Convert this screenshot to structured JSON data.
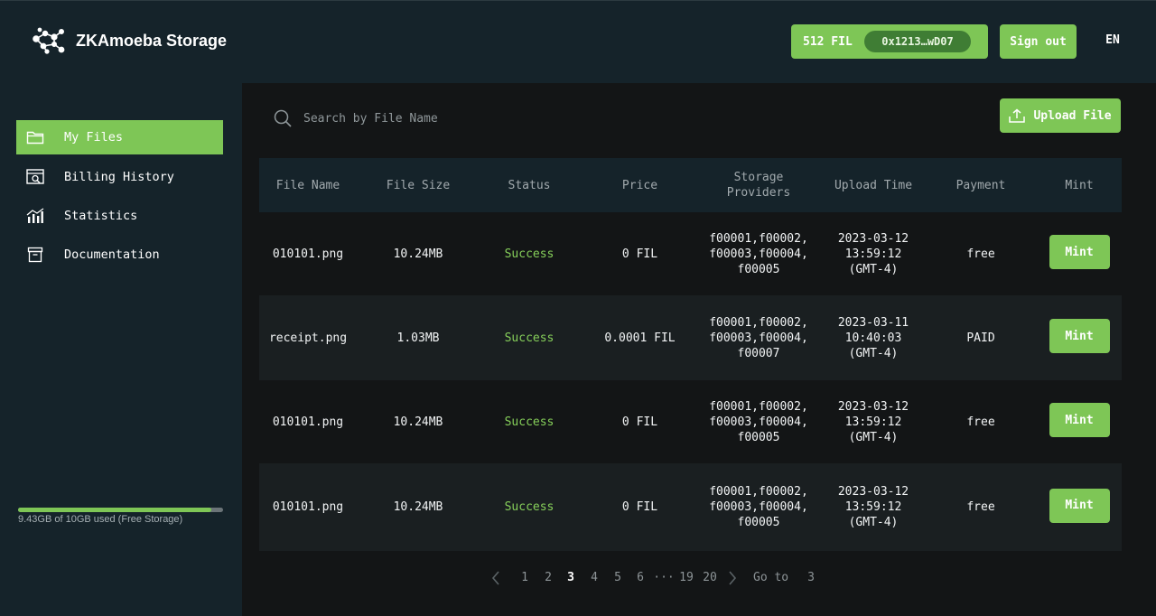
{
  "app": {
    "title": "ZKAmoeba Storage"
  },
  "header": {
    "balance": "512 FIL",
    "address": "0x1213…wD07",
    "signout_label": "Sign out",
    "language": "EN"
  },
  "sidebar": {
    "items": [
      {
        "label": "My Files",
        "icon": "folder-icon",
        "active": true
      },
      {
        "label": "Billing History",
        "icon": "billing-icon",
        "active": false
      },
      {
        "label": "Statistics",
        "icon": "chart-icon",
        "active": false
      },
      {
        "label": "Documentation",
        "icon": "archive-icon",
        "active": false
      }
    ],
    "storage": {
      "text": "9.43GB of 10GB used (Free Storage)",
      "used_fraction": 0.943
    }
  },
  "search": {
    "placeholder": "Search by File Name"
  },
  "upload_label": "Upload File",
  "table": {
    "columns": [
      "File Name",
      "File Size",
      "Status",
      "Price",
      "Storage\nProviders",
      "Upload Time",
      "Payment",
      "Mint"
    ],
    "rows": [
      {
        "file_name": "010101.png",
        "file_size": "10.24MB",
        "status": "Success",
        "price": "0 FIL",
        "providers": [
          "f00001,f00002,",
          "f00003,f00004,",
          "f00005"
        ],
        "upload_time": [
          "2023-03-12",
          "13:59:12",
          "(GMT-4)"
        ],
        "payment": "free",
        "mint": "Mint"
      },
      {
        "file_name": "receipt.png",
        "file_size": "1.03MB",
        "status": "Success",
        "price": "0.0001 FIL",
        "providers": [
          "f00001,f00002,",
          "f00003,f00004,",
          "f00007"
        ],
        "upload_time": [
          "2023-03-11",
          "10:40:03",
          "(GMT-4)"
        ],
        "payment": "PAID",
        "mint": "Mint"
      },
      {
        "file_name": "010101.png",
        "file_size": "10.24MB",
        "status": "Success",
        "price": "0 FIL",
        "providers": [
          "f00001,f00002,",
          "f00003,f00004,",
          "f00005"
        ],
        "upload_time": [
          "2023-03-12",
          "13:59:12",
          "(GMT-4)"
        ],
        "payment": "free",
        "mint": "Mint"
      },
      {
        "file_name": "010101.png",
        "file_size": "10.24MB",
        "status": "Success",
        "price": "0 FIL",
        "providers": [
          "f00001,f00002,",
          "f00003,f00004,",
          "f00005"
        ],
        "upload_time": [
          "2023-03-12",
          "13:59:12",
          "(GMT-4)"
        ],
        "payment": "free",
        "mint": "Mint"
      }
    ]
  },
  "pagination": {
    "pages": [
      "1",
      "2",
      "3",
      "4",
      "5",
      "6",
      "···",
      "19",
      "20"
    ],
    "current": "3",
    "goto_label": "Go to",
    "goto_value": "3"
  },
  "colors": {
    "accent": "#7ec656",
    "status_success": "#86cf5a",
    "header_bg": "#15232a",
    "page_bg": "#131516"
  }
}
